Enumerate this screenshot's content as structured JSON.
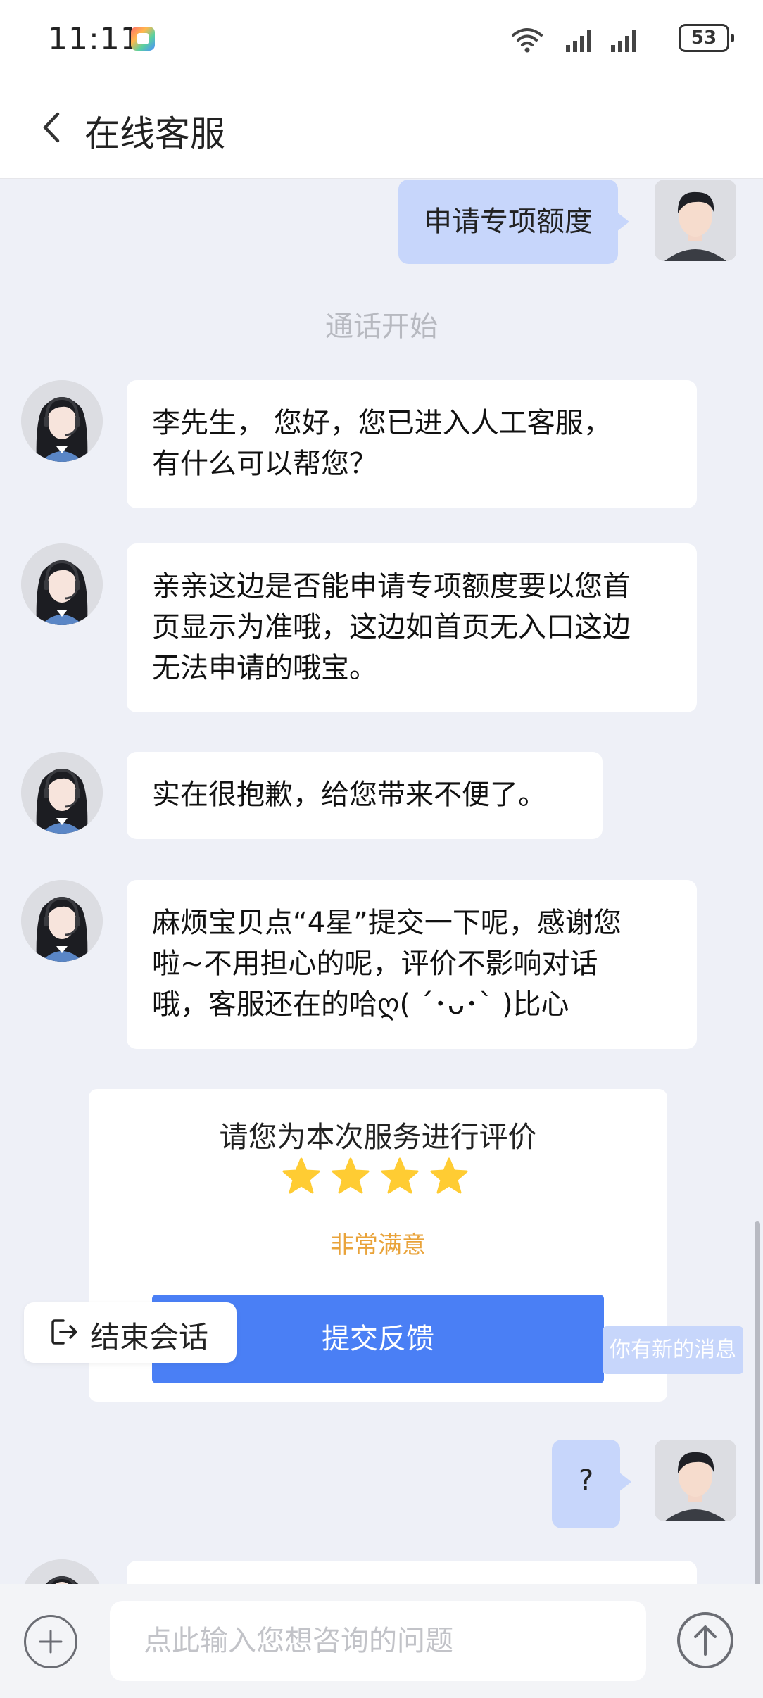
{
  "status_bar": {
    "time": "11:11",
    "battery": "53"
  },
  "nav": {
    "title": "在线客服"
  },
  "chat": {
    "messages": [
      {
        "from": "user",
        "text": "申请专项额度"
      },
      {
        "from": "system",
        "text": "通话开始"
      },
      {
        "from": "agent",
        "lines": [
          "李先生， 您好，您已进入人工客服，",
          "有什么可以帮您？"
        ]
      },
      {
        "from": "agent",
        "lines": [
          "亲亲这边是否能申请专项额度要以您首",
          "页显示为准哦，这边如首页无入口这边",
          "无法申请的哦宝。"
        ]
      },
      {
        "from": "agent",
        "lines": [
          "实在很抱歉，给您带来不便了。"
        ]
      },
      {
        "from": "agent",
        "lines": [
          "麻烦宝贝点“4星”提交一下呢，感谢您",
          "啦~不用担心的呢，评价不影响对话",
          "哦，客服还在的哈ღ( ´･ᴗ･` )比心"
        ]
      },
      {
        "from": "user",
        "text": "?"
      }
    ]
  },
  "rating_card": {
    "title": "请您为本次服务进行评价",
    "stars_filled": 4,
    "star_color": "#ffcc33",
    "label": "非常满意",
    "submit_label": "提交反馈"
  },
  "end_chat": {
    "label": "结束会话"
  },
  "new_message_toast": "你有新的消息",
  "input": {
    "placeholder": "点此输入您想咨询的问题",
    "value": ""
  },
  "colors": {
    "accent": "#4a7ff5",
    "user_bubble": "#c7d6fb",
    "background": "#eef0f7"
  }
}
